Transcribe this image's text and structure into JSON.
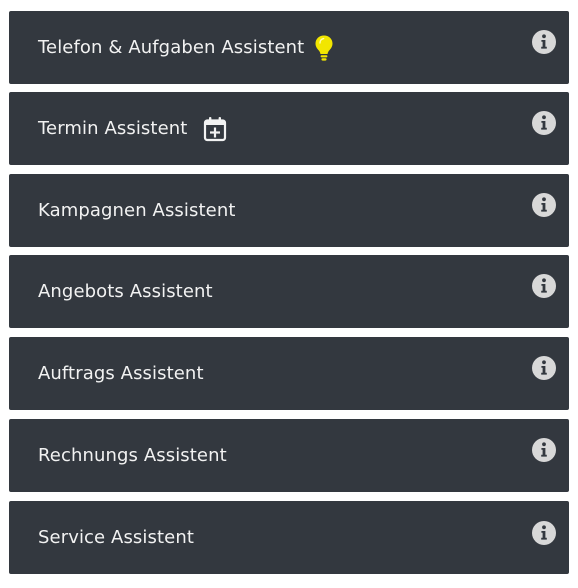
{
  "assistants": [
    {
      "label": "Telefon & Aufgaben Assistent",
      "icon": "lightbulb-icon",
      "icon_color": "#f2e600"
    },
    {
      "label": "Termin Assistent",
      "icon": "calendar-plus-icon",
      "icon_color": "#f2f2f2"
    },
    {
      "label": "Kampagnen Assistent",
      "icon": null
    },
    {
      "label": "Angebots Assistent",
      "icon": null
    },
    {
      "label": "Auftrags Assistent",
      "icon": null
    },
    {
      "label": "Rechnungs Assistent",
      "icon": null
    },
    {
      "label": "Service Assistent",
      "icon": null
    }
  ],
  "info_icon": "info-icon",
  "colors": {
    "tile_background": "#33383f",
    "text": "#f2f2f2",
    "info_icon": "#d8d8d8",
    "page_background": "#ffffff"
  }
}
